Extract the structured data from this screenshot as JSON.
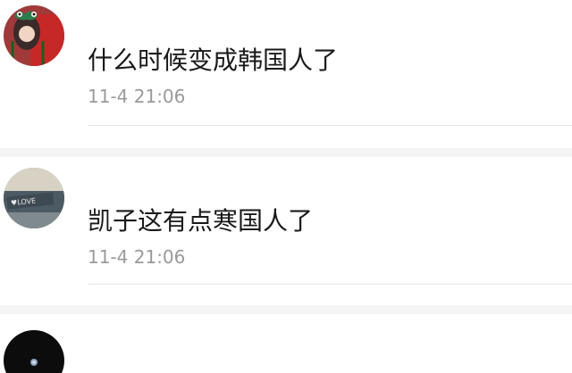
{
  "comments": [
    {
      "username": "",
      "text": "什么时候变成韩国人了",
      "time": "11-4 21:06"
    },
    {
      "username": "",
      "text": "凯子这有点寒国人了",
      "time": "11-4 21:06"
    },
    {
      "username": "",
      "text": "",
      "time": ""
    }
  ]
}
